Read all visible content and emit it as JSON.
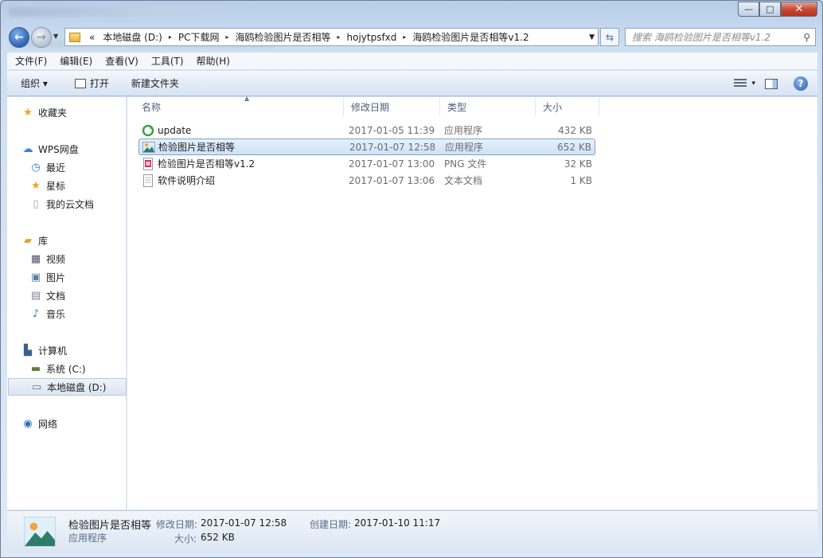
{
  "window": {
    "minimize": "—",
    "maximize": "□",
    "close": "✕"
  },
  "address": {
    "back_glyph": "←",
    "forward_glyph": "→",
    "overflow": "«",
    "crumbs": [
      "本地磁盘 (D:)",
      "PC下载网",
      "海鸥检验图片是否相等",
      "hojytpsfxd",
      "海鸥检验图片是否相等v1.2"
    ],
    "separator": "▸"
  },
  "search": {
    "placeholder": "搜索 海鸥检验图片是否相等v1.2"
  },
  "menu": [
    "文件(F)",
    "编辑(E)",
    "查看(V)",
    "工具(T)",
    "帮助(H)"
  ],
  "toolbar": {
    "organize": "组织 ▾",
    "open": "打开",
    "new_folder": "新建文件夹",
    "view_dropdown": "▾",
    "help": "?"
  },
  "sidebar": {
    "favorites": "收藏夹",
    "wps": "WPS网盘",
    "recent": "最近",
    "starred": "星标",
    "my_cloud_docs": "我的云文档",
    "library": "库",
    "videos": "视频",
    "pictures": "图片",
    "documents": "文档",
    "music": "音乐",
    "computer": "计算机",
    "drive_c": "系统 (C:)",
    "drive_d": "本地磁盘 (D:)",
    "network": "网络"
  },
  "columns": {
    "name": "名称",
    "modified": "修改日期",
    "type": "类型",
    "size": "大小",
    "sort_glyph": "▲"
  },
  "files": [
    {
      "name": "update",
      "modified": "2017-01-05 11:39",
      "type": "应用程序",
      "size": "432 KB",
      "icon": "update-icon"
    },
    {
      "name": "检验图片是否相等",
      "modified": "2017-01-07 12:58",
      "type": "应用程序",
      "size": "652 KB",
      "icon": "app-image-icon"
    },
    {
      "name": "检验图片是否相等v1.2",
      "modified": "2017-01-07 13:00",
      "type": "PNG 文件",
      "size": "32 KB",
      "icon": "png-icon"
    },
    {
      "name": "软件说明介绍",
      "modified": "2017-01-07 13:06",
      "type": "文本文档",
      "size": "1 KB",
      "icon": "text-file-icon"
    }
  ],
  "details": {
    "name": "检验图片是否相等",
    "type": "应用程序",
    "modified_label": "修改日期:",
    "modified": "2017-01-07 12:58",
    "created_label": "创建日期:",
    "created": "2017-01-10 11:17",
    "size_label": "大小:",
    "size": "652 KB"
  },
  "colors": {
    "selection_border": "#7da2ce",
    "selection_fill": "#cfe2f8",
    "accent": "#2f63b5"
  }
}
